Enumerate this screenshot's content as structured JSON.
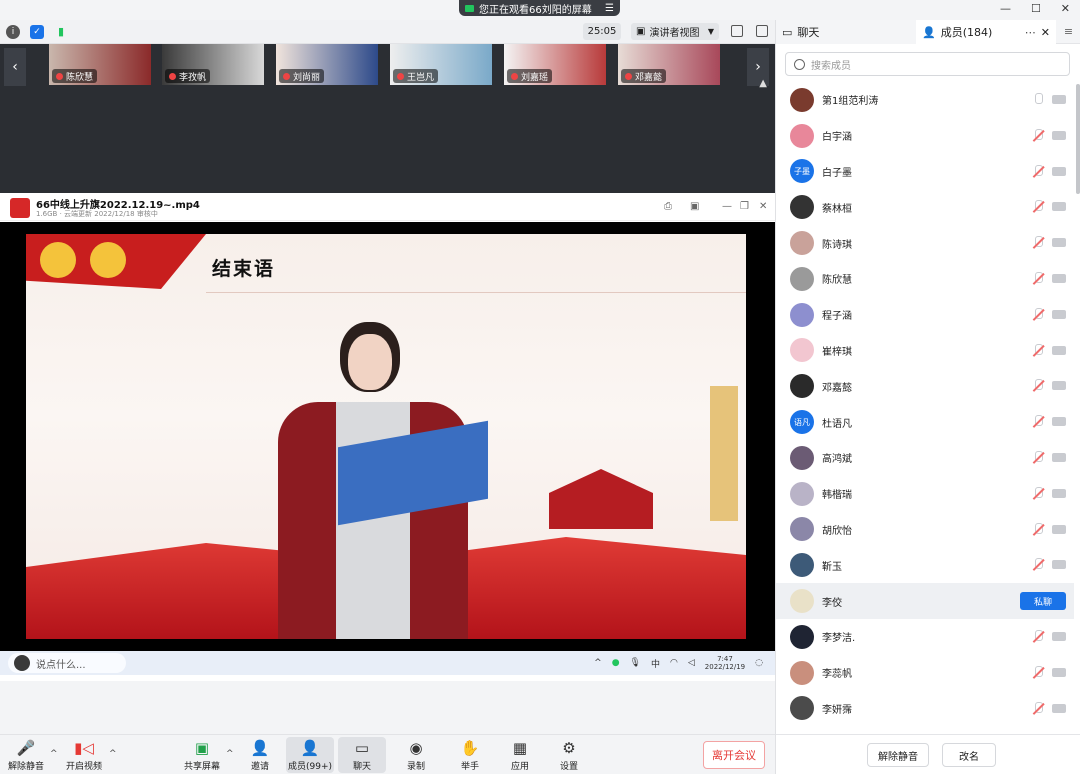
{
  "banner": {
    "text": "您正在观看66刘阳的屏幕"
  },
  "topbar": {
    "timer": "25:05",
    "view_mode": "演讲者视图"
  },
  "gallery": {
    "tiles": [
      {
        "name": "陈欣慧"
      },
      {
        "name": "李孜帆"
      },
      {
        "name": "刘尚丽"
      },
      {
        "name": "王岂凡"
      },
      {
        "name": "刘嘉瑶"
      },
      {
        "name": "邓嘉懿"
      }
    ]
  },
  "shared_window": {
    "file_title": "66中线上升旗2022.12.19~.mp4",
    "file_meta": "1.6GB · 云端更新 2022/12/18 审核中",
    "slide_title": "结束语"
  },
  "taskbar": {
    "search_placeholder": "说点什么...",
    "time": "7:47",
    "date": "2022/12/19",
    "lang": "中"
  },
  "toolbar": {
    "unmute": "解除静音",
    "start_video": "开启视频",
    "share_screen": "共享屏幕",
    "invite": "邀请",
    "members": "成员(99+)",
    "chat": "聊天",
    "record": "录制",
    "raise_hand": "举手",
    "apps": "应用",
    "settings": "设置",
    "leave": "离开会议"
  },
  "side": {
    "tab_chat": "聊天",
    "tab_members": "成员(184)",
    "search_placeholder": "搜索成员",
    "members": [
      {
        "name": "第1组范利涛",
        "avatar_text": "",
        "avatar_color": "#7a3b2e",
        "mic": "off-gray"
      },
      {
        "name": "白宇涵",
        "avatar_text": "",
        "avatar_color": "#e8879a",
        "mic": "muted"
      },
      {
        "name": "白子墨",
        "avatar_text": "子墨",
        "avatar_color": "#1a73e8",
        "mic": "muted"
      },
      {
        "name": "蔡林桓",
        "avatar_text": "",
        "avatar_color": "#333333",
        "mic": "muted"
      },
      {
        "name": "陈诗琪",
        "avatar_text": "",
        "avatar_color": "#c9a29a",
        "mic": "muted"
      },
      {
        "name": "陈欣慧",
        "avatar_text": "",
        "avatar_color": "#9a9a9a",
        "mic": "muted"
      },
      {
        "name": "程子涵",
        "avatar_text": "",
        "avatar_color": "#8d8fcf",
        "mic": "muted"
      },
      {
        "name": "崔梓琪",
        "avatar_text": "",
        "avatar_color": "#f2c6d0",
        "mic": "muted"
      },
      {
        "name": "邓嘉懿",
        "avatar_text": "",
        "avatar_color": "#2a2a2a",
        "mic": "muted"
      },
      {
        "name": "杜语凡",
        "avatar_text": "语凡",
        "avatar_color": "#1a73e8",
        "mic": "muted"
      },
      {
        "name": "高鸿斌",
        "avatar_text": "",
        "avatar_color": "#6b5b74",
        "mic": "muted"
      },
      {
        "name": "韩楷瑞",
        "avatar_text": "",
        "avatar_color": "#b9b3c7",
        "mic": "muted"
      },
      {
        "name": "胡欣怡",
        "avatar_text": "",
        "avatar_color": "#8b87a8",
        "mic": "muted"
      },
      {
        "name": "靳玉",
        "avatar_text": "",
        "avatar_color": "#3d5a78",
        "mic": "muted"
      },
      {
        "name": "李佼",
        "avatar_text": "",
        "avatar_color": "#e9e1c8",
        "mic": "none",
        "private_chat": "私聊"
      },
      {
        "name": "李梦洁.",
        "avatar_text": "",
        "avatar_color": "#1f2433",
        "mic": "muted"
      },
      {
        "name": "李蕊帆",
        "avatar_text": "",
        "avatar_color": "#c98f7d",
        "mic": "muted"
      },
      {
        "name": "李妍霈",
        "avatar_text": "",
        "avatar_color": "#4b4b4b",
        "mic": "muted"
      }
    ],
    "footer_unmute": "解除静音",
    "footer_rename": "改名"
  }
}
